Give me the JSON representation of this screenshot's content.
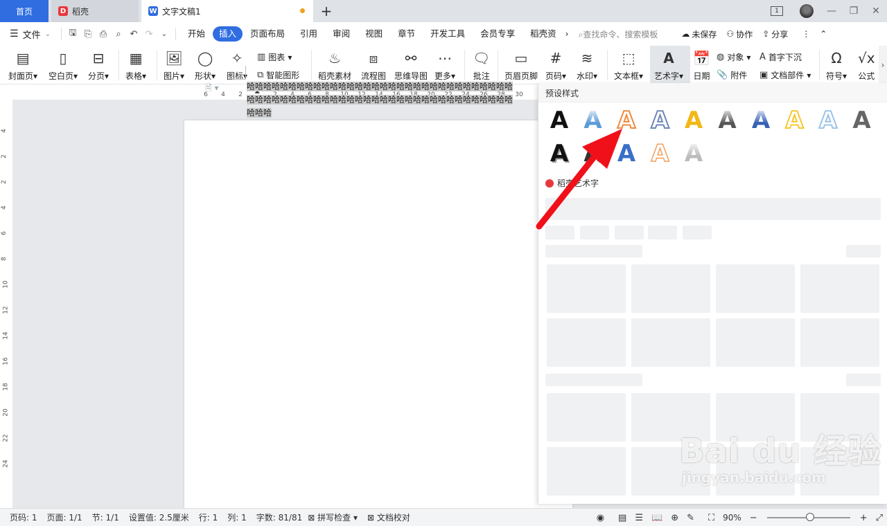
{
  "tabs": {
    "home": "首页",
    "daoke": "稻壳",
    "doc": "文字文稿1",
    "new": "+"
  },
  "window": {
    "layout_icon": "1",
    "minimize": "—",
    "restore": "❐",
    "close": "✕"
  },
  "menu": {
    "file": "文件",
    "tabs": [
      "开始",
      "插入",
      "页面布局",
      "引用",
      "审阅",
      "视图",
      "章节",
      "开发工具",
      "会员专享",
      "稻壳资"
    ],
    "active_tab": "插入",
    "search": "查找命令、搜索模板",
    "unsaved": "未保存",
    "collab": "协作",
    "share": "分享"
  },
  "ribbon": {
    "cover": "封面页",
    "blank": "空白页",
    "pagebreak": "分页",
    "table": "表格",
    "picture": "图片",
    "shape": "形状",
    "icon": "图标",
    "chart": "图表",
    "smartart": "智能图形",
    "daoke_material": "稻壳素材",
    "flowchart": "流程图",
    "mindmap": "思维导图",
    "more": "更多",
    "comment": "批注",
    "header_footer": "页眉页脚",
    "page_number": "页码",
    "watermark": "水印",
    "textbox": "文本框",
    "arttext": "艺术字",
    "date": "日期",
    "object": "对象",
    "attachment": "附件",
    "dropcap": "首字下沉",
    "docpart": "文档部件",
    "symbol": "符号",
    "formula": "公式"
  },
  "ruler": {
    "h_ticks": [
      "6",
      "4",
      "2",
      "2",
      "4",
      "6",
      "8",
      "10",
      "12",
      "14",
      "16",
      "18",
      "20",
      "22",
      "24",
      "26",
      "28",
      "30"
    ],
    "v_ticks": [
      "4",
      "2",
      "2",
      "4",
      "6",
      "8",
      "10",
      "12",
      "14",
      "16",
      "18",
      "20",
      "22",
      "24"
    ]
  },
  "document": {
    "line1": "哈哈哈哈哈哈哈哈哈哈哈哈哈哈哈哈哈哈哈哈哈哈哈哈哈哈哈哈哈哈哈哈",
    "line2": "哈哈哈哈哈哈哈哈哈哈哈哈哈哈哈哈哈哈哈哈哈哈哈哈哈哈哈哈哈哈哈哈",
    "line3": "哈哈哈"
  },
  "panel": {
    "title": "预设样式",
    "preset_glyph": "A",
    "daoke_section": "稻壳艺术字",
    "presets": [
      {
        "color": "#111111",
        "style": "solid-black"
      },
      {
        "color": "#5a9ad8",
        "style": "blue-gradient"
      },
      {
        "color": "#f08a3c",
        "style": "orange-outline"
      },
      {
        "color": "#6d87b8",
        "style": "blue-outline"
      },
      {
        "color": "#f2b818",
        "style": "gold"
      },
      {
        "color": "#555555",
        "style": "gray-gradient"
      },
      {
        "color": "#3561b4",
        "style": "blue-reflect"
      },
      {
        "color": "#f5c832",
        "style": "yellow-outline"
      },
      {
        "color": "#9cc4e8",
        "style": "light-blue-outline"
      },
      {
        "color": "#666666",
        "style": "gray"
      },
      {
        "color": "#111111",
        "style": "black-shadow"
      },
      {
        "color": "#333333",
        "style": "dark-shadow"
      },
      {
        "color": "#3a6fc8",
        "style": "blue-3d"
      },
      {
        "color": "#f0a060",
        "style": "orange-light"
      },
      {
        "color": "#bbbbbb",
        "style": "silver"
      }
    ]
  },
  "status": {
    "page": "页码: 1",
    "pages": "页面: 1/1",
    "section": "节: 1/1",
    "setting": "设置值: 2.5厘米",
    "row": "行: 1",
    "col": "列: 1",
    "words": "字数: 81/81",
    "spell": "拼写检查",
    "proof": "文档校对",
    "zoom": "90%"
  },
  "watermark": {
    "logo": "Bai du 经验",
    "url": "jingyan.baidu.com"
  },
  "colors": {
    "accent": "#2f6de1",
    "arrow": "#f0101a"
  }
}
